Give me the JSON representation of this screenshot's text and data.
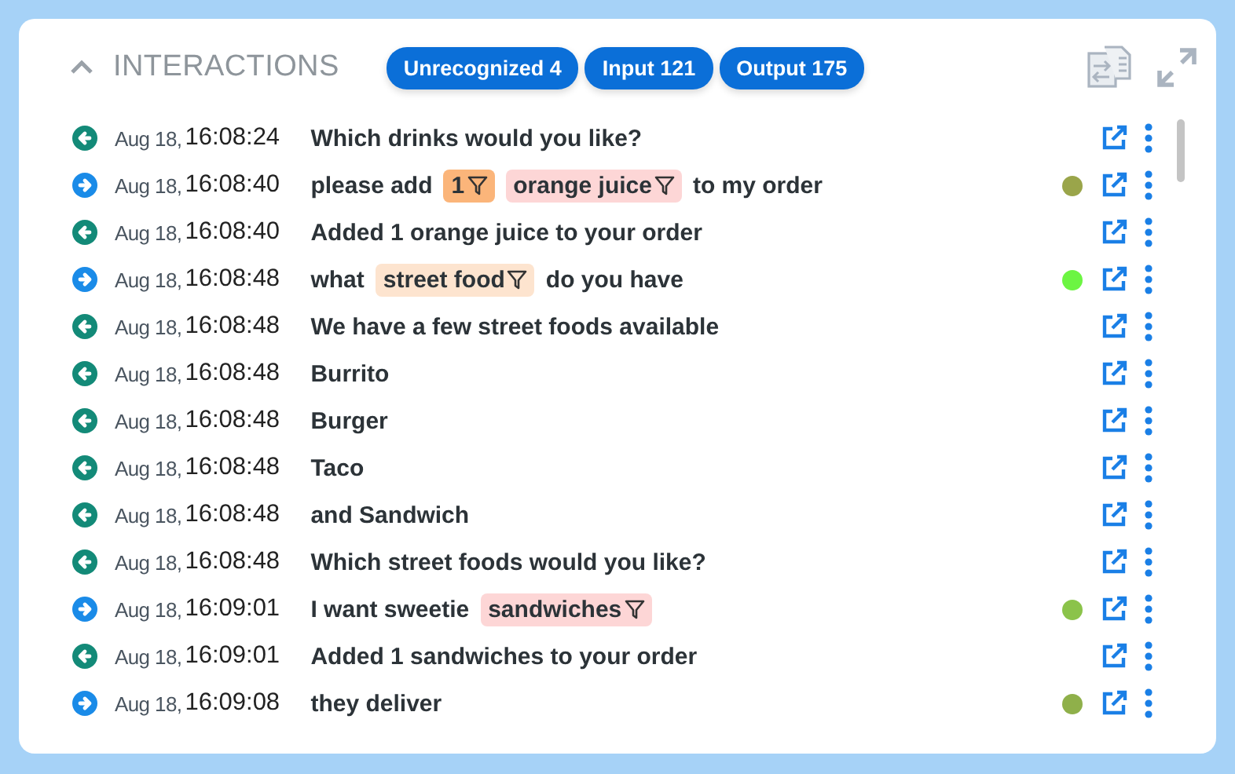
{
  "header": {
    "title": "INTERACTIONS",
    "expanded": true,
    "badges": [
      "Unrecognized 4",
      "Input 121",
      "Output 175"
    ]
  },
  "rows": [
    {
      "kind": "output",
      "date": "Aug 18,",
      "time": "16:08:24",
      "parts": [
        {
          "text": "Which drinks would you like?"
        }
      ]
    },
    {
      "kind": "input",
      "date": "Aug 18,",
      "time": "16:08:40",
      "parts": [
        {
          "text": "please add"
        },
        {
          "tag": "1",
          "color": "#fbb57a"
        },
        {
          "tag": "orange juice",
          "color": "#fdd6d6"
        },
        {
          "text": "to my order"
        }
      ],
      "color": "#9aa54a"
    },
    {
      "kind": "output",
      "date": "Aug 18,",
      "time": "16:08:40",
      "parts": [
        {
          "text": "Added 1 orange juice to your order"
        }
      ]
    },
    {
      "kind": "input",
      "date": "Aug 18,",
      "time": "16:08:48",
      "parts": [
        {
          "text": "what"
        },
        {
          "tag": "street food",
          "color": "#fde4cf"
        },
        {
          "text": "do you have"
        }
      ],
      "color": "#6cf542"
    },
    {
      "kind": "output",
      "date": "Aug 18,",
      "time": "16:08:48",
      "parts": [
        {
          "text": "We have a few street foods available"
        }
      ]
    },
    {
      "kind": "output",
      "date": "Aug 18,",
      "time": "16:08:48",
      "parts": [
        {
          "text": "Burrito"
        }
      ]
    },
    {
      "kind": "output",
      "date": "Aug 18,",
      "time": "16:08:48",
      "parts": [
        {
          "text": "Burger"
        }
      ]
    },
    {
      "kind": "output",
      "date": "Aug 18,",
      "time": "16:08:48",
      "parts": [
        {
          "text": "Taco"
        }
      ]
    },
    {
      "kind": "output",
      "date": "Aug 18,",
      "time": "16:08:48",
      "parts": [
        {
          "text": "and Sandwich"
        }
      ]
    },
    {
      "kind": "output",
      "date": "Aug 18,",
      "time": "16:08:48",
      "parts": [
        {
          "text": "Which street foods would you like?"
        }
      ]
    },
    {
      "kind": "input",
      "date": "Aug 18,",
      "time": "16:09:01",
      "parts": [
        {
          "text": "I want sweetie"
        },
        {
          "tag": "sandwiches",
          "color": "#fdd6d6"
        }
      ],
      "color": "#8bc34a"
    },
    {
      "kind": "output",
      "date": "Aug 18,",
      "time": "16:09:01",
      "parts": [
        {
          "text": "Added 1 sandwiches to your order"
        }
      ]
    },
    {
      "kind": "input",
      "date": "Aug 18,",
      "time": "16:09:08",
      "parts": [
        {
          "text": "they deliver"
        }
      ],
      "color": "#8fb04a"
    }
  ]
}
